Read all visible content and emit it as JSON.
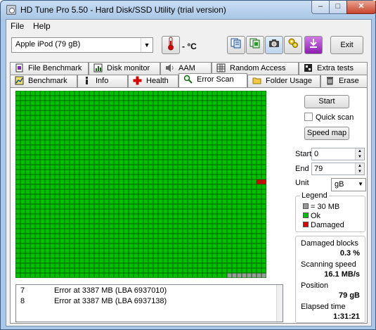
{
  "window": {
    "title": "HD Tune Pro 5.50 - Hard Disk/SSD Utility (trial version)"
  },
  "menu": {
    "file": "File",
    "help": "Help"
  },
  "toolbar": {
    "drive": "Apple   iPod (79 gB)",
    "temperature": "- °C",
    "icons": [
      "copy-info-icon",
      "copy-screenshot-icon",
      "camera-icon",
      "options-icon",
      "save-icon"
    ],
    "exit_label": "Exit"
  },
  "tabs_back": [
    {
      "label": "File Benchmark",
      "icon": "file-icon"
    },
    {
      "label": "Disk monitor",
      "icon": "chart-icon"
    },
    {
      "label": "AAM",
      "icon": "speaker-icon"
    },
    {
      "label": "Random Access",
      "icon": "grid-icon"
    },
    {
      "label": "Extra tests",
      "icon": "tests-icon"
    }
  ],
  "tabs_front": [
    {
      "label": "Benchmark",
      "icon": "benchmark-icon"
    },
    {
      "label": "Info",
      "icon": "info-icon"
    },
    {
      "label": "Health",
      "icon": "health-icon"
    },
    {
      "label": "Error Scan",
      "icon": "magnifier-icon",
      "active": true
    },
    {
      "label": "Folder Usage",
      "icon": "folder-icon"
    },
    {
      "label": "Erase",
      "icon": "trash-icon"
    }
  ],
  "controls": {
    "start_label": "Start",
    "quick_scan_label": "Quick scan",
    "quick_scan_checked": false,
    "speed_map_label": "Speed map",
    "start_field_label": "Start",
    "start_value": "0",
    "end_field_label": "End",
    "end_value": "79",
    "unit_label": "Unit",
    "unit_value": "gB"
  },
  "legend": {
    "title": "Legend",
    "items": [
      {
        "label": "= 30 MB",
        "color": "#999999"
      },
      {
        "label": "Ok",
        "color": "#00c000"
      },
      {
        "label": "Damaged",
        "color": "#dd0000"
      }
    ]
  },
  "stats": {
    "damaged_blocks_label": "Damaged blocks",
    "damaged_blocks_value": "0.3 %",
    "scanning_speed_label": "Scanning speed",
    "scanning_speed_value": "16.1 MB/s",
    "position_label": "Position",
    "position_value": "79 gB",
    "elapsed_label": "Elapsed time",
    "elapsed_value": "1:31:21"
  },
  "log": [
    {
      "num": "7",
      "msg": "Error at 3387 MB (LBA 6937010)"
    },
    {
      "num": "8",
      "msg": "Error at 3387 MB (LBA 6937138)"
    }
  ],
  "scan_map": {
    "block_color_ok": "#00c000",
    "block_color_damaged": "#dd0000",
    "block_color_pending": "#999999",
    "grid_line_color": "#006600",
    "damaged_blocks": [
      [
        49,
        18
      ],
      [
        50,
        18
      ]
    ],
    "unscanned_tail_count": 8
  }
}
